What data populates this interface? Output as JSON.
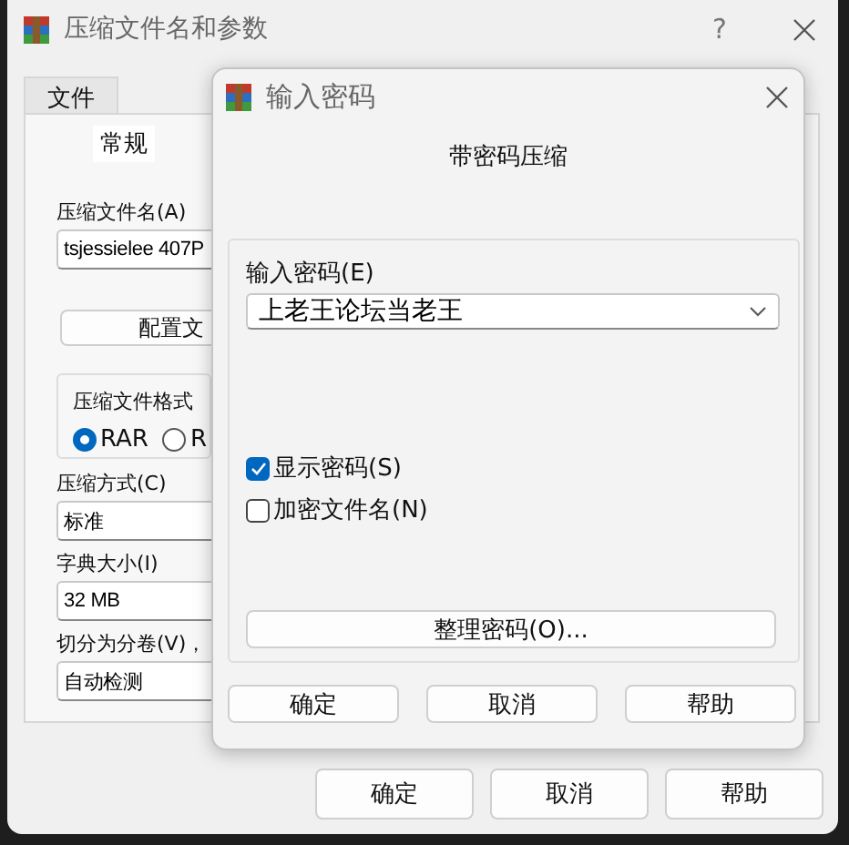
{
  "main_window": {
    "title": "压缩文件名和参数",
    "help_button": "?",
    "tabs": [
      {
        "label": "文件",
        "selected": false
      },
      {
        "label": "常规",
        "selected": true
      }
    ],
    "archive_name": {
      "label": "压缩文件名(A)",
      "value": "tsjessielee 407P"
    },
    "profiles_button": "配置文",
    "format_group": {
      "title": "压缩文件格式",
      "options": [
        {
          "label": "RAR",
          "selected": true
        },
        {
          "label": "R",
          "selected": false
        }
      ]
    },
    "fields": [
      {
        "label": "压缩方式(C)",
        "value": "标准"
      },
      {
        "label": "字典大小(I)",
        "value": "32 MB"
      },
      {
        "label": "切分为分卷(V)，",
        "value": "自动检测"
      }
    ],
    "buttons": [
      "确定",
      "取消",
      "帮助"
    ]
  },
  "dialog": {
    "title": "输入密码",
    "heading": "带密码压缩",
    "password": {
      "label": "输入密码(E)",
      "value": "上老王论坛当老王"
    },
    "checks": [
      {
        "label": "显示密码(S)",
        "checked": true
      },
      {
        "label": "加密文件名(N)",
        "checked": false
      }
    ],
    "organize_button": "整理密码(O)...",
    "buttons": [
      "确定",
      "取消",
      "帮助"
    ]
  }
}
